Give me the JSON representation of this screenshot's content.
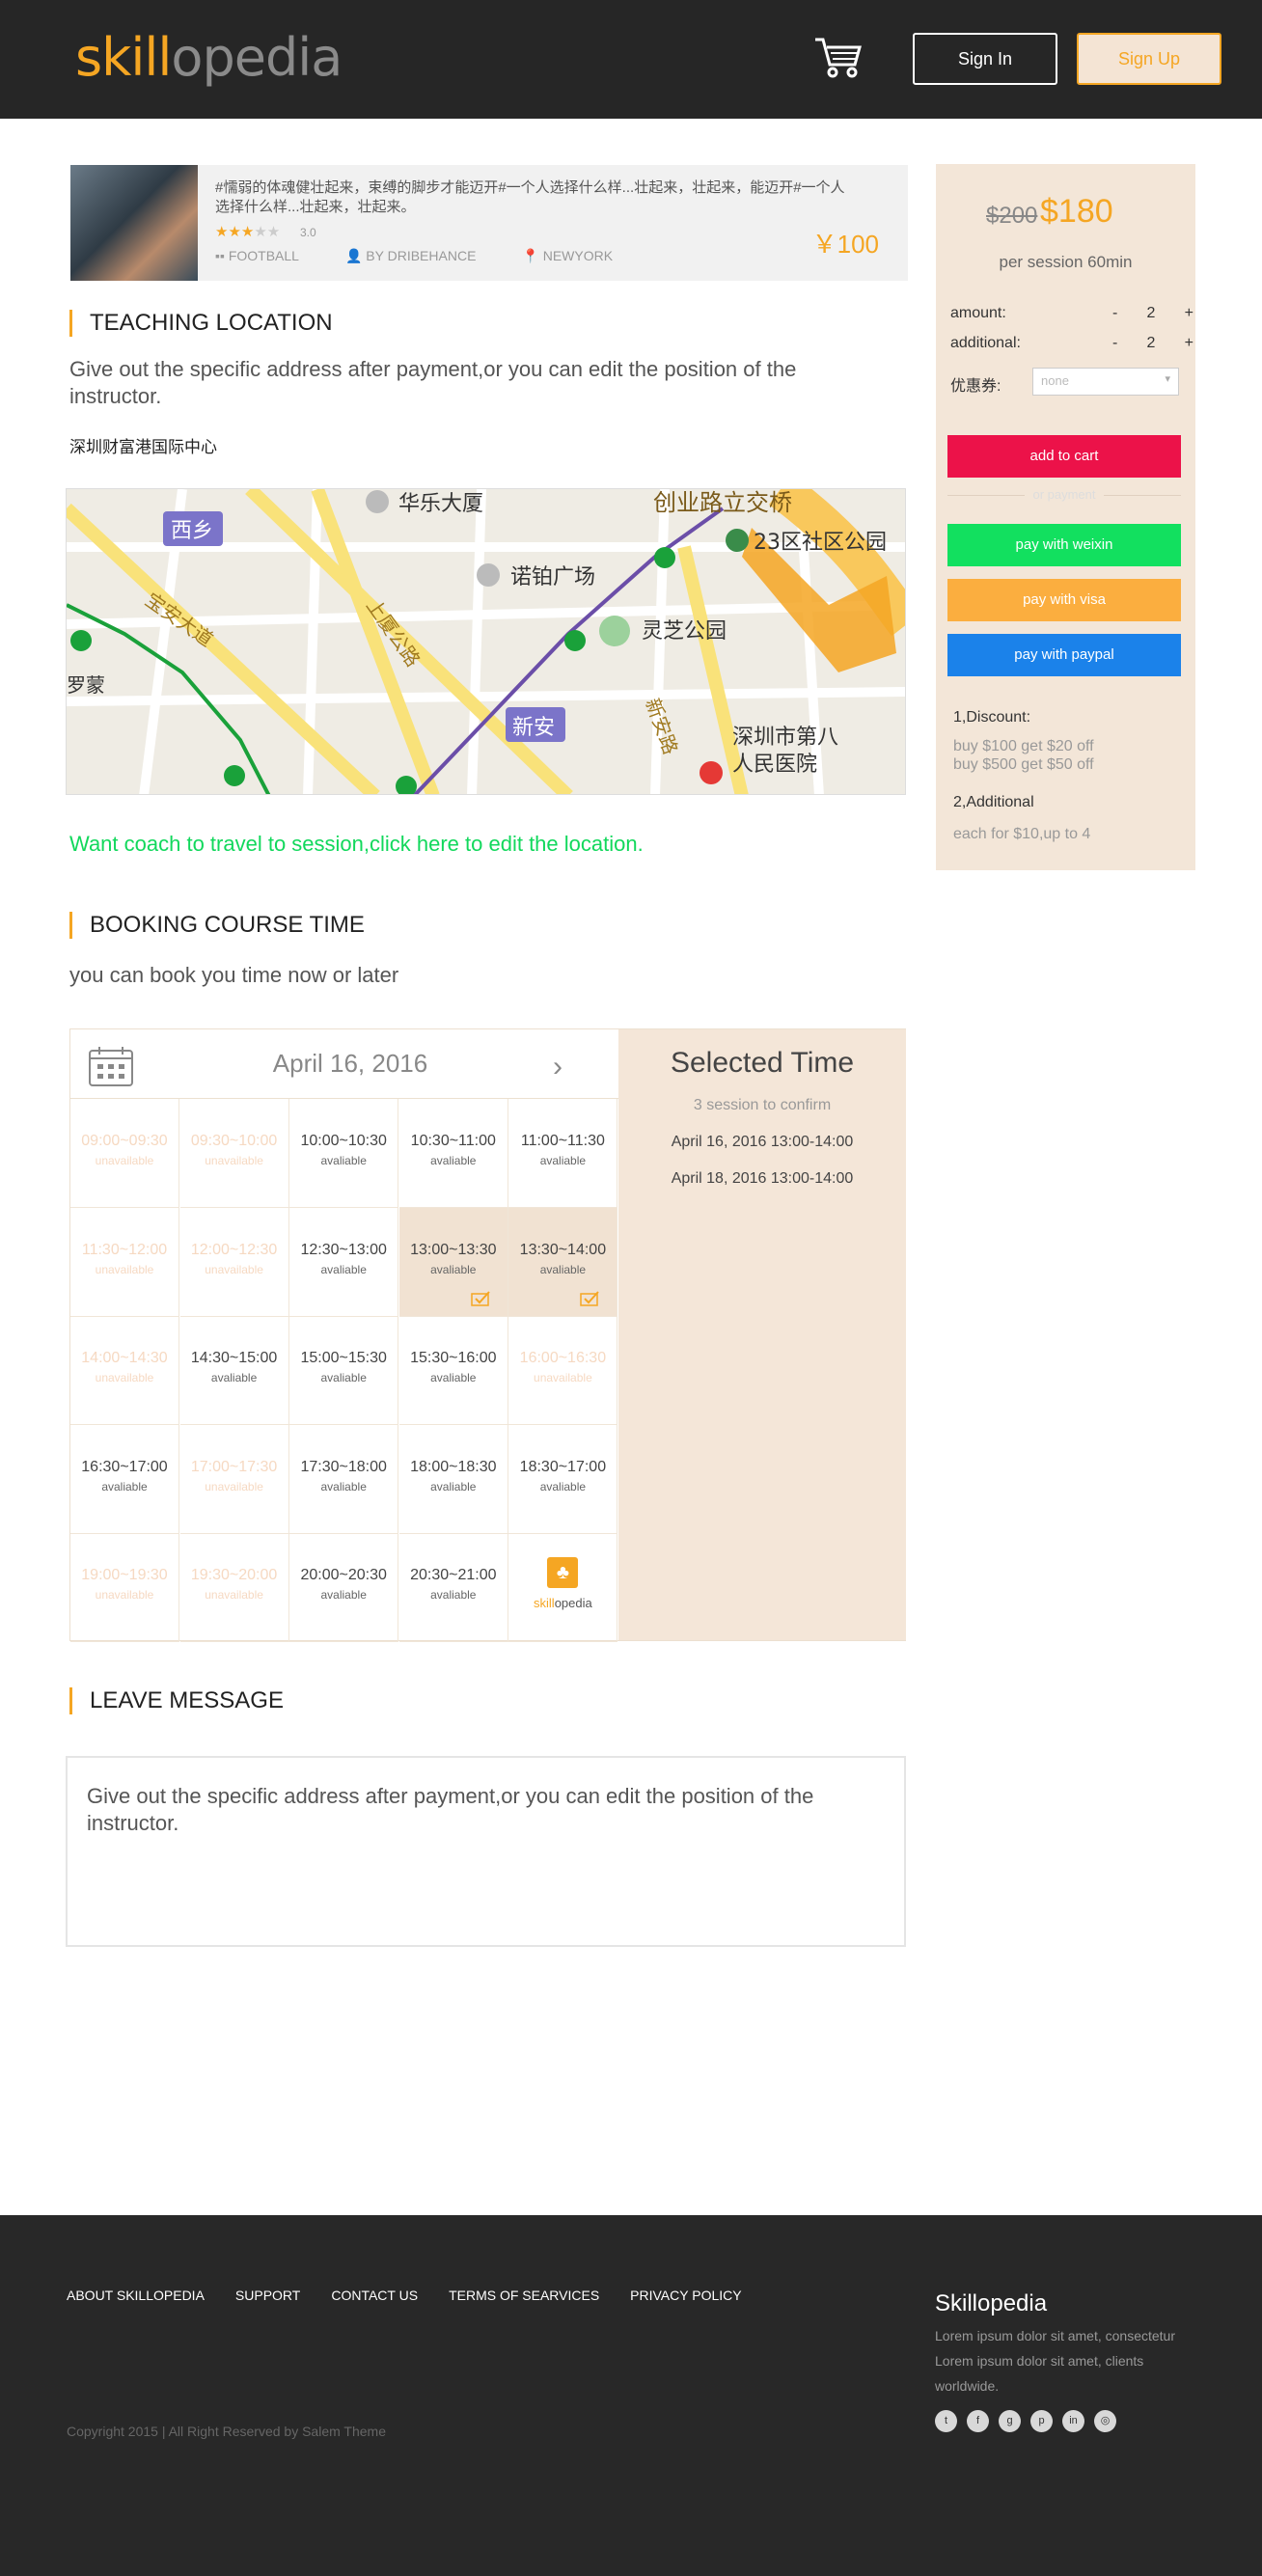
{
  "header": {
    "logo_a": "skill",
    "logo_b": "opedia",
    "signin": "Sign In",
    "signup": "Sign Up"
  },
  "course": {
    "description": "#懦弱的体魂健壮起来，束缚的脚步才能迈开#一个人选择什么样...壮起来，壮起来，能迈开#一个人选择什么样...壮起来，壮起来。",
    "rating": "3.0",
    "stars": 3,
    "category": "FOOTBALL",
    "author": "BY DRIBEHANCE",
    "location": "NEWYORK",
    "price": "￥100"
  },
  "teaching": {
    "title": "TEACHING LOCATION",
    "desc": "Give out the specific address after payment,or you can edit the position of the instructor.",
    "address": "深圳财富港国际中心",
    "edit_link": "Want coach to travel to session,click here to edit the location."
  },
  "map": {
    "labels": [
      "西乡",
      "华乐大厦",
      "创业路立交桥",
      "23区社区公园",
      "诺铂广场",
      "灵芝公园",
      "宝安大道",
      "罗蒙",
      "新安",
      "深圳市第八",
      "人民医院",
      "上厦公路",
      "新安路"
    ]
  },
  "booking": {
    "title": "BOOKING COURSE TIME",
    "desc": "you can book you time now or later",
    "date": "April 16, 2016",
    "slots": [
      {
        "t": "09:00~09:30",
        "s": "unavailable",
        "st": "un"
      },
      {
        "t": "09:30~10:00",
        "s": "unavailable",
        "st": "un"
      },
      {
        "t": "10:00~10:30",
        "s": "avaliable",
        "st": "av"
      },
      {
        "t": "10:30~11:00",
        "s": "avaliable",
        "st": "av"
      },
      {
        "t": "11:00~11:30",
        "s": "avaliable",
        "st": "av"
      },
      {
        "t": "11:30~12:00",
        "s": "unavailable",
        "st": "un"
      },
      {
        "t": "12:00~12:30",
        "s": "unavailable",
        "st": "un"
      },
      {
        "t": "12:30~13:00",
        "s": "avaliable",
        "st": "av"
      },
      {
        "t": "13:00~13:30",
        "s": "avaliable",
        "st": "sel"
      },
      {
        "t": "13:30~14:00",
        "s": "avaliable",
        "st": "sel"
      },
      {
        "t": "14:00~14:30",
        "s": "unavailable",
        "st": "un"
      },
      {
        "t": "14:30~15:00",
        "s": "avaliable",
        "st": "av"
      },
      {
        "t": "15:00~15:30",
        "s": "avaliable",
        "st": "av"
      },
      {
        "t": "15:30~16:00",
        "s": "avaliable",
        "st": "av"
      },
      {
        "t": "16:00~16:30",
        "s": "unavailable",
        "st": "un"
      },
      {
        "t": "16:30~17:00",
        "s": "avaliable",
        "st": "av"
      },
      {
        "t": "17:00~17:30",
        "s": "unavailable",
        "st": "un"
      },
      {
        "t": "17:30~18:00",
        "s": "avaliable",
        "st": "av"
      },
      {
        "t": "18:00~18:30",
        "s": "avaliable",
        "st": "av"
      },
      {
        "t": "18:30~17:00",
        "s": "avaliable",
        "st": "av"
      },
      {
        "t": "19:00~19:30",
        "s": "unavailable",
        "st": "un"
      },
      {
        "t": "19:30~20:00",
        "s": "unavailable",
        "st": "un"
      },
      {
        "t": "20:00~20:30",
        "s": "avaliable",
        "st": "av"
      },
      {
        "t": "20:30~21:00",
        "s": "avaliable",
        "st": "av"
      },
      {
        "t": "",
        "s": "",
        "st": "logo"
      }
    ],
    "selected": {
      "title": "Selected Time",
      "confirm": "3 session to confirm",
      "items": [
        "April 16, 2016 13:00-14:00",
        "April 18, 2016 13:00-14:00"
      ]
    }
  },
  "message": {
    "title": "LEAVE MESSAGE",
    "text": "Give out the specific address after payment,or you can edit the position of the instructor."
  },
  "sidebar": {
    "old_price": "$200",
    "new_price": "$180",
    "per": "per session 60min",
    "amount_label": "amount:",
    "amount": "2",
    "additional_label": "additional:",
    "additional": "2",
    "coupon_label": "优惠券:",
    "coupon_placeholder": "none",
    "minus": "-",
    "plus": "+",
    "add_cart": "add to cart",
    "or_payment": "or payment",
    "weixin": "pay with weixin",
    "visa": "pay with visa",
    "paypal": "pay with paypal",
    "discount_title": "1,Discount:",
    "discount_1": "buy $100 get $20 off",
    "discount_2": "buy $500 get $50 off",
    "additional_title": "2,Additional",
    "additional_desc": "each for $10,up to 4"
  },
  "footer": {
    "links": [
      "ABOUT SKILLOPEDIA",
      "SUPPORT",
      "CONTACT US",
      "TERMS OF SEARVICES",
      "PRIVACY POLICY"
    ],
    "copyright": "Copyright 2015 | All Right Reserved by Salem Theme",
    "brand": "Skillopedia",
    "text": "Lorem ipsum dolor sit amet, consectetur Lorem ipsum dolor sit amet,  clients worldwide.",
    "social": [
      "twitter-icon",
      "facebook-icon",
      "google-plus-icon",
      "pinterest-icon",
      "linkedin-icon",
      "dribbble-icon"
    ]
  },
  "colors": {
    "accent": "#f5a623",
    "add_cart": "#ec1249",
    "weixin": "#12e05f",
    "visa": "#fbae3f",
    "paypal": "#1b82ea",
    "link": "#12d85c"
  }
}
